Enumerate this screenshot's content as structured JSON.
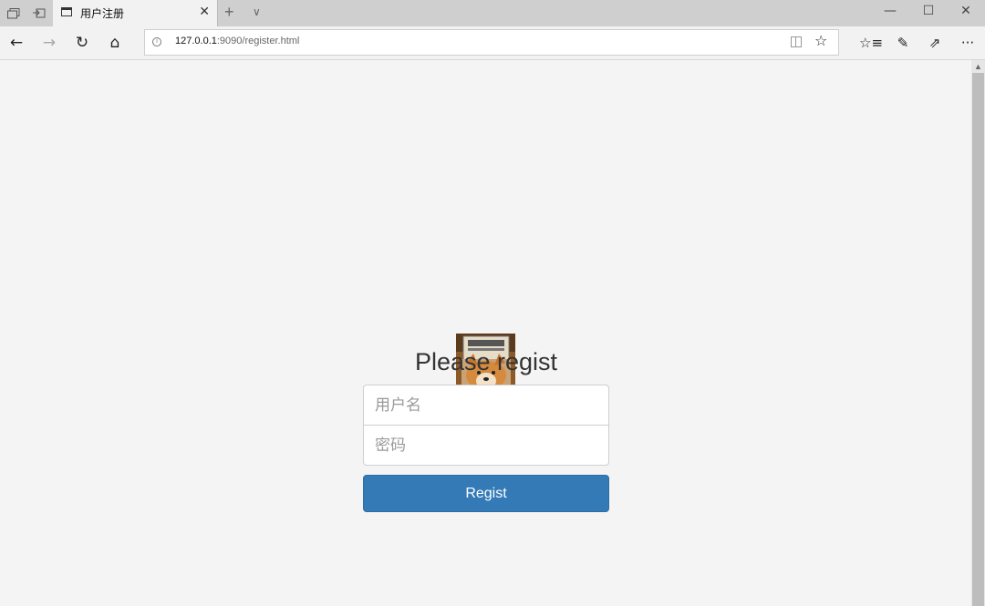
{
  "browser": {
    "tab_title": "用户注册",
    "tab_close": "✕",
    "new_tab": "+",
    "tab_list": "∨",
    "url_host": "127.0.0.1",
    "url_path": ":9090/register.html",
    "info_glyph": "i",
    "window": {
      "minimize": "—",
      "maximize": "☐",
      "close": "✕"
    },
    "nav": {
      "back": "←",
      "forward": "→",
      "refresh": "↻",
      "home": "⌂"
    },
    "bookmark": "☆",
    "tools": {
      "favorites": "☆≡",
      "notes": "✎",
      "share": "⇗",
      "more": "···"
    }
  },
  "page": {
    "heading": "Please regist",
    "username_placeholder": "用户名",
    "password_placeholder": "密码",
    "submit_label": "Regist"
  },
  "colors": {
    "button": "#337ab7",
    "background": "#f4f4f4"
  }
}
